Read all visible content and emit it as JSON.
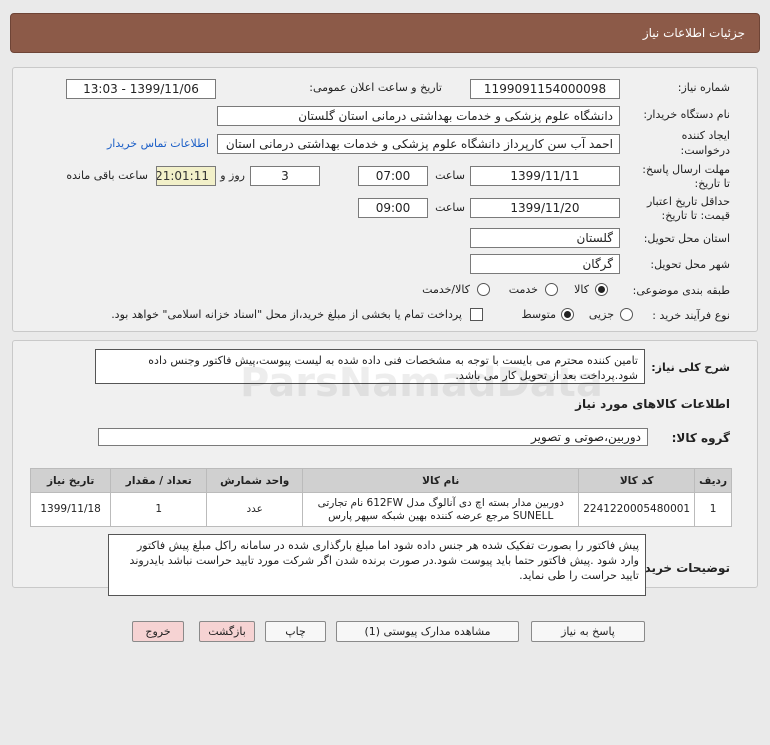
{
  "header": {
    "title": "جزئیات اطلاعات نیاز"
  },
  "info": {
    "need_number_label": "شماره نیاز:",
    "need_number": "1199091154000098",
    "announce_label": "تاریخ و ساعت اعلان عمومی:",
    "announce_value": "1399/11/06 - 13:03",
    "buyer_org_label": "نام دستگاه خریدار:",
    "buyer_org": "دانشگاه علوم پزشکی و خدمات بهداشتی درمانی استان گلستان",
    "requester_label_1": "ایجاد کننده",
    "requester_label_2": "درخواست:",
    "requester": "احمد آب سن کارپرداز دانشگاه علوم پزشکی و خدمات بهداشتی درمانی استان",
    "contact_link": "اطلاعات تماس خریدار",
    "reply_deadline_label_1": "مهلت ارسال پاسخ:",
    "reply_deadline_label_2": "تا تاریخ:",
    "reply_date": "1399/11/11",
    "time_label": "ساعت",
    "reply_time": "07:00",
    "days_value": "3",
    "days_label": "روز و",
    "countdown": "21:01:11",
    "remaining_label": "ساعت باقی مانده",
    "price_validity_label_1": "حداقل تاریخ اعتبار",
    "price_validity_label_2": "قیمت: تا تاریخ:",
    "validity_date": "1399/11/20",
    "validity_time": "09:00",
    "province_label": "استان محل تحویل:",
    "province": "گلستان",
    "city_label": "شهر محل تحویل:",
    "city": "گرگان",
    "category_label": "طبقه بندی موضوعی:",
    "category_options": [
      "کالا",
      "خدمت",
      "کالا/خدمت"
    ],
    "purchase_type_label": "نوع فرآیند خرید :",
    "purchase_options": [
      "جزیی",
      "متوسط"
    ],
    "payment_note": "پرداخت تمام یا بخشی از مبلغ خرید،از محل \"اسناد خزانه اسلامی\" خواهد بود."
  },
  "description": {
    "label": "شرح کلی نیاز:",
    "text": "تامین کننده محترم می بایست با توجه به مشخصات فنی داده شده به لیست پیوست،پیش فاکتور وجنس داده شود.پرداخت بعد از تحویل کار می باشد."
  },
  "goods": {
    "section_title": "اطلاعات کالاهای مورد نیاز",
    "group_label": "گروه کالا:",
    "group_value": "دوربین،صوتی و تصویر",
    "columns": [
      "ردیف",
      "کد کالا",
      "نام کالا",
      "واحد شمارش",
      "تعداد / مقدار",
      "تاریخ نیاز"
    ],
    "rows": [
      {
        "index": "1",
        "code": "2241220005480001",
        "name_line1": "دوربین مدار بسته اچ دی آنالوگ مدل 612FW نام تجارتی",
        "name_line2": "SUNELL مرجع عرضه کننده بهین شبکه سپهر پارس",
        "unit": "عدد",
        "qty": "1",
        "date": "1399/11/18"
      }
    ]
  },
  "buyer_notes": {
    "label": "توضیحات خریدار:",
    "text": "پیش فاکتور را بصورت تفکیک شده هر جنس داده شود اما مبلغ بارگذاری شده در سامانه راکل مبلغ پیش فاکتور وارد شود .پیش فاکتور حتما باید پیوست شود.در صورت برنده شدن اگر شرکت مورد تایید حراست نباشد بایدروند تایید حراست را طی نماید."
  },
  "buttons": {
    "reply": "پاسخ به نیاز",
    "attachments": "مشاهده مدارک پیوستی (1)",
    "print": "چاپ",
    "back": "بازگشت",
    "exit": "خروج"
  },
  "watermark": "ParsNamadData"
}
